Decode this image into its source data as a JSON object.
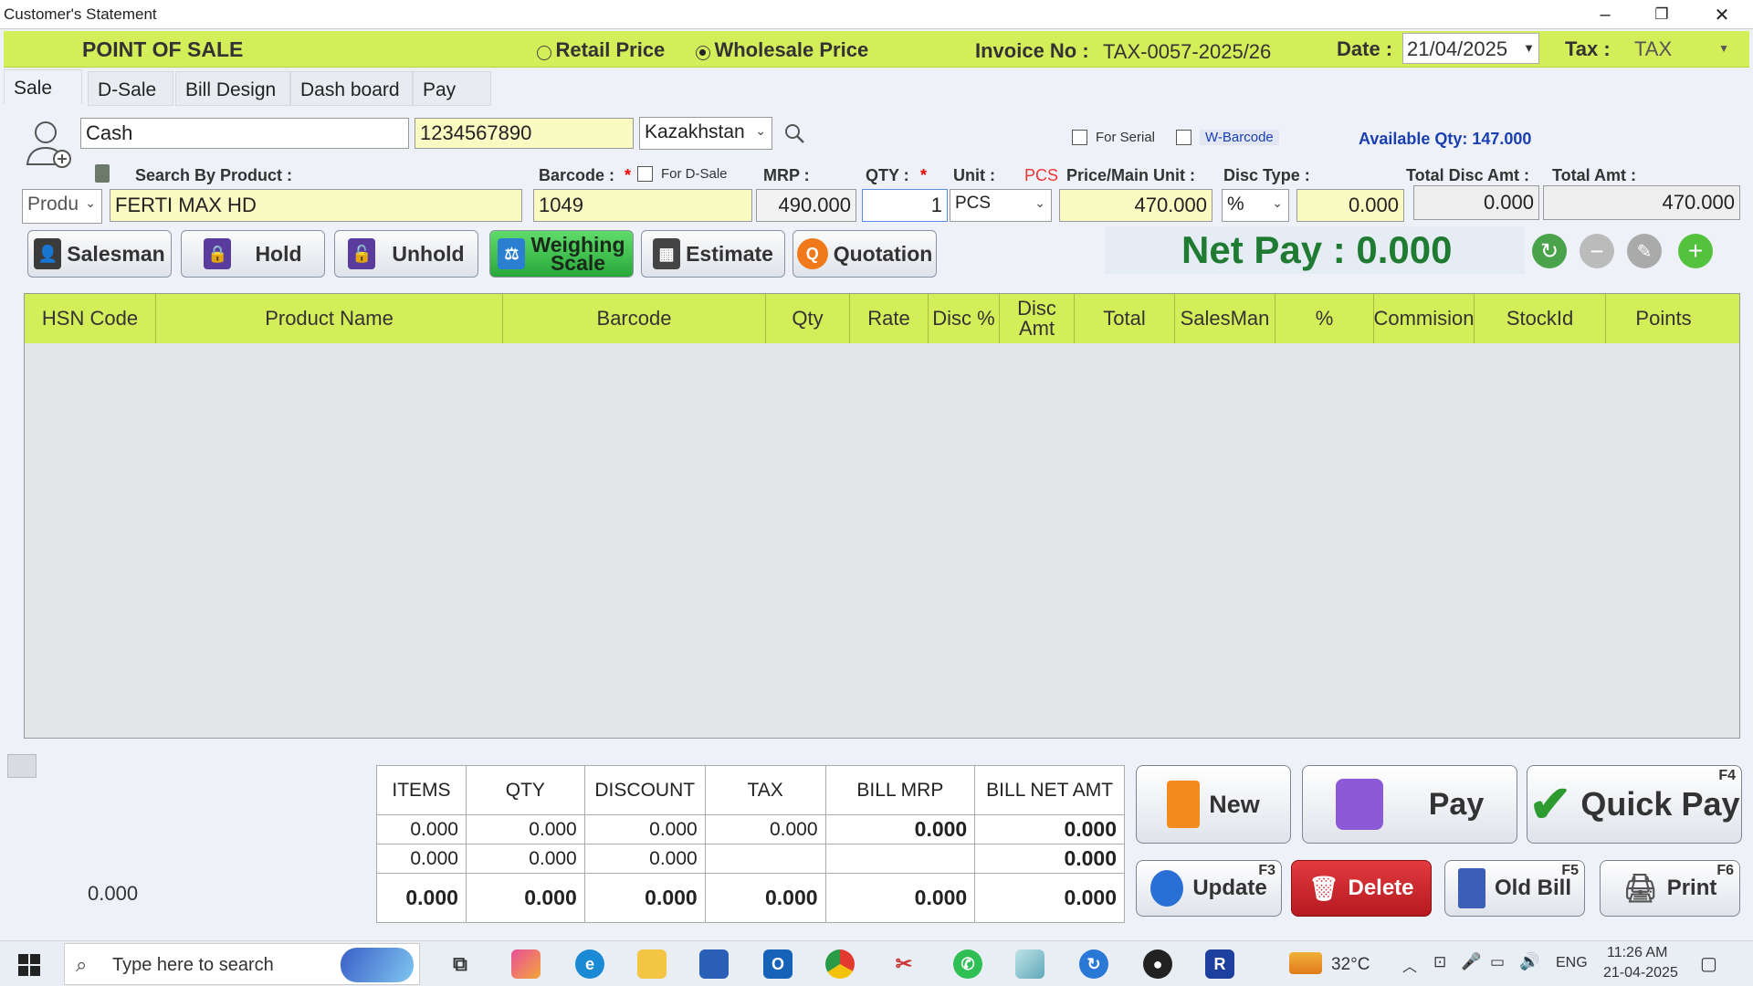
{
  "window": {
    "title": "Customer's Statement",
    "minimize": "–",
    "restore": "❐",
    "close": "✕"
  },
  "banner": {
    "title": "POINT OF SALE",
    "retail_label": "Retail Price",
    "wholesale_label": "Wholesale Price",
    "selected_price": "Wholesale Price",
    "invoice_label": "Invoice No :",
    "invoice_value": "TAX-0057-2025/26",
    "date_label": "Date :",
    "date_value": "21/04/2025",
    "tax_label": "Tax :",
    "tax_value": "TAX"
  },
  "tabs": [
    "Sale",
    "D-Sale",
    "Bill Design",
    "Dash board",
    "Pay"
  ],
  "customer": {
    "name": "Cash",
    "phone": "1234567890",
    "country": "Kazakhstan"
  },
  "options": {
    "for_serial": "For Serial",
    "w_barcode": "W-Barcode",
    "available_qty": "Available Qty: 147.000"
  },
  "labels": {
    "search_by_product": "Search By Product :",
    "barcode": "Barcode :",
    "for_dsale": "For D-Sale",
    "mrp": "MRP :",
    "qty": "QTY :",
    "req": "*",
    "unit": "Unit :",
    "unit_hint": "PCS",
    "price_main_unit": "Price/Main Unit :",
    "disc_type": "Disc Type :",
    "total_disc_amt": "Total Disc Amt :",
    "total_amt": "Total Amt :"
  },
  "entry": {
    "search_type": "Produ",
    "product": "FERTI MAX HD",
    "barcode": "1049",
    "mrp": "490.000",
    "qty": "1",
    "unit": "PCS",
    "price": "470.000",
    "disc_type": "%",
    "disc_value": "0.000",
    "total_disc_amt": "0.000",
    "total_amt": "470.000"
  },
  "actions": {
    "salesman": "Salesman",
    "hold": "Hold",
    "unhold": "Unhold",
    "weighing_1": "Weighing",
    "weighing_2": "Scale",
    "estimate": "Estimate",
    "quotation": "Quotation"
  },
  "net_pay": "Net Pay : 0.000",
  "grid_columns": [
    "HSN Code",
    "Product Name",
    "Barcode",
    "Qty",
    "Rate",
    "Disc %",
    "Disc Amt",
    "Total",
    "SalesMan",
    "%",
    "Commision",
    "StockId",
    "Points"
  ],
  "left_total": "0.000",
  "summary": {
    "headers": [
      "ITEMS",
      "QTY",
      "DISCOUNT",
      "TAX",
      "BILL MRP",
      "BILL NET AMT"
    ],
    "rows": [
      [
        "0.000",
        "0.000",
        "0.000",
        "0.000",
        "0.000",
        "0.000"
      ],
      [
        "0.000",
        "0.000",
        "0.000",
        "",
        "",
        "0.000"
      ],
      [
        "0.000",
        "0.000",
        "0.000",
        "0.000",
        "0.000",
        "0.000"
      ]
    ]
  },
  "bottom_buttons": {
    "new": "New",
    "pay": "Pay",
    "quick_pay": "Quick Pay",
    "quick_pay_key": "F4",
    "update": "Update",
    "update_key": "F3",
    "delete": "Delete",
    "old_bill": "Old Bill",
    "old_bill_key": "F5",
    "print": "Print",
    "print_key": "F6"
  },
  "taskbar": {
    "search_placeholder": "Type here to search",
    "weather": "32°C",
    "lang": "ENG",
    "time": "11:26 AM",
    "date": "21-04-2025"
  },
  "colors": {
    "banner": "#d4ee5a",
    "netpay": "#1f7a32",
    "delete": "#d0242a",
    "accent_blue": "#1a3fb0"
  }
}
